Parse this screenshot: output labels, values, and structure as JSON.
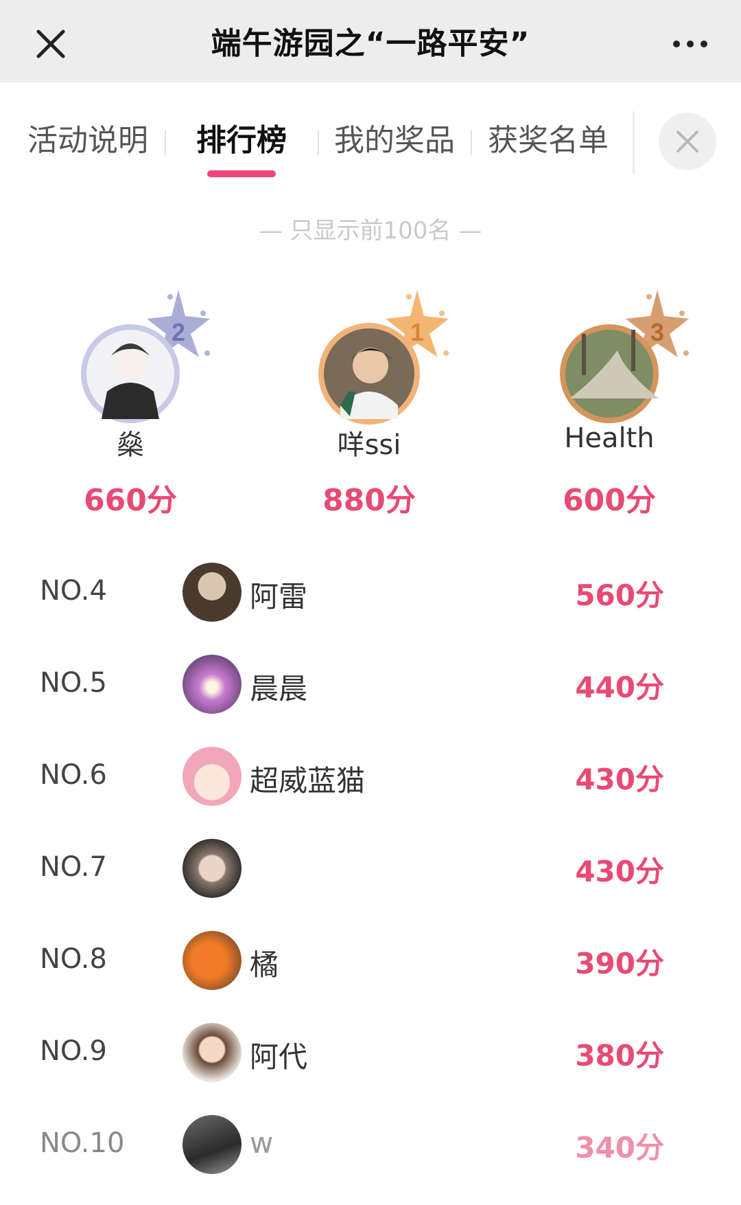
{
  "window": {
    "title": "端午游园之“一路平安”",
    "close_icon": "close-icon",
    "more_icon": "more-horizontal-icon"
  },
  "tabs": [
    {
      "label": "活动说明",
      "active": false
    },
    {
      "label": "排行榜",
      "active": true
    },
    {
      "label": "我的奖品",
      "active": false
    },
    {
      "label": "获奖名单",
      "active": false
    }
  ],
  "notice": "— 只显示前100名 —",
  "accent_color": "#e84a73",
  "podium": [
    {
      "rank": "2",
      "name": "燊",
      "score": "660分",
      "badge_color": "#8f93c9"
    },
    {
      "rank": "1",
      "name": "咩ssi",
      "score": "880分",
      "badge_color": "#f0a65a"
    },
    {
      "rank": "3",
      "name": "Health",
      "score": "600分",
      "badge_color": "#c98550"
    }
  ],
  "list": [
    {
      "rank": "NO.4",
      "name": "阿雷",
      "score": "560分"
    },
    {
      "rank": "NO.5",
      "name": "晨晨",
      "score": "440分"
    },
    {
      "rank": "NO.6",
      "name": "超威蓝猫",
      "score": "430分"
    },
    {
      "rank": "NO.7",
      "name": "",
      "score": "430分"
    },
    {
      "rank": "NO.8",
      "name": "橘",
      "score": "390分"
    },
    {
      "rank": "NO.9",
      "name": "阿代",
      "score": "380分"
    },
    {
      "rank": "NO.10",
      "name": "w",
      "score": "340分"
    }
  ]
}
